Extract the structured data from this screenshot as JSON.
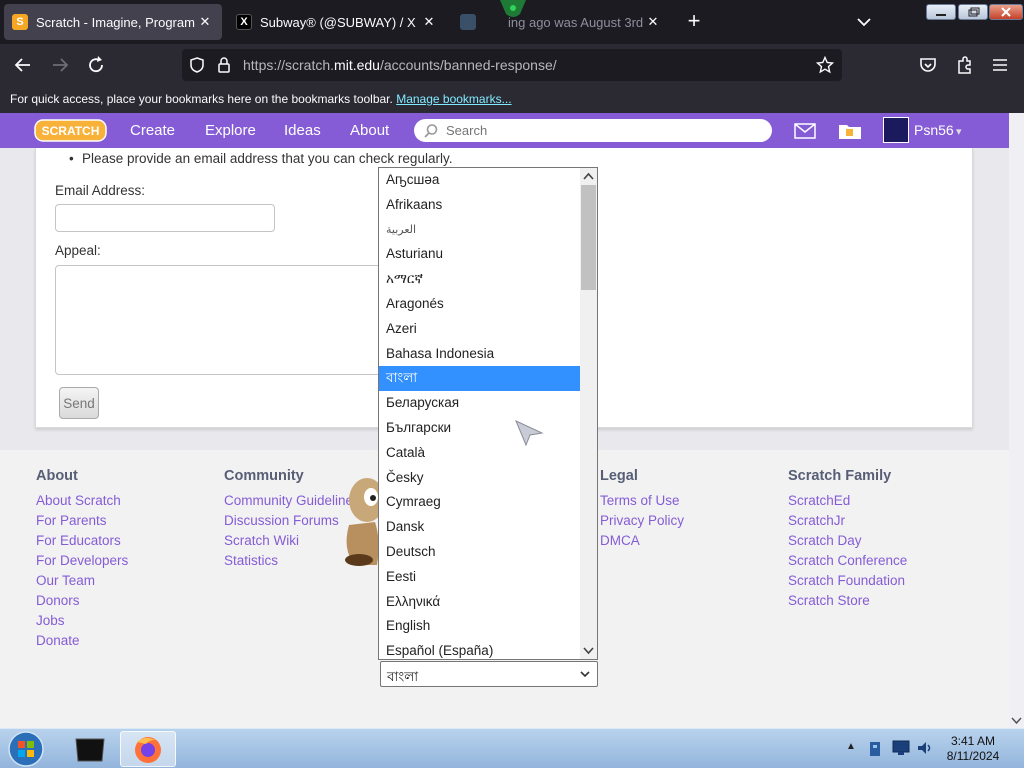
{
  "browser": {
    "tabs": [
      {
        "title": "Scratch - Imagine, Program, Sh",
        "close": "✕",
        "favicon": "scratch-cat-icon"
      },
      {
        "title": "Subway® (@SUBWAY) / X",
        "close": "✕",
        "favicon": "x-logo-icon"
      },
      {
        "title": "ing ago was August 3rd",
        "close": "✕",
        "favicon": "generic-page-icon"
      }
    ],
    "new_tab": "+",
    "url": {
      "prefix": "https://scratch.",
      "domain": "mit.edu",
      "path": "/accounts/banned-response/"
    },
    "bookmarks_bar": {
      "text": "For quick access, place your bookmarks here on the bookmarks toolbar.",
      "link": "Manage bookmarks..."
    }
  },
  "scratch_nav": {
    "logo": "SCRATCH",
    "links": [
      "Create",
      "Explore",
      "Ideas",
      "About"
    ],
    "search_placeholder": "Search",
    "username": "Psn56",
    "caret": "▾"
  },
  "form": {
    "bullet": "Please provide an email address that you can check regularly.",
    "email_label": "Email Address:",
    "appeal_label": "Appeal:",
    "send_label": "Send"
  },
  "footer": {
    "columns": [
      {
        "heading": "About",
        "links": [
          "About Scratch",
          "For Parents",
          "For Educators",
          "For Developers",
          "Our Team",
          "Donors",
          "Jobs",
          "Donate"
        ]
      },
      {
        "heading": "Community",
        "links": [
          "Community Guidelines",
          "Discussion Forums",
          "Scratch Wiki",
          "Statistics"
        ]
      },
      {
        "heading": "Legal",
        "links": [
          "Terms of Use",
          "Privacy Policy",
          "DMCA"
        ]
      },
      {
        "heading": "Scratch Family",
        "links": [
          "ScratchEd",
          "ScratchJr",
          "Scratch Day",
          "Scratch Conference",
          "Scratch Foundation",
          "Scratch Store"
        ]
      }
    ]
  },
  "language_dropdown": {
    "options": [
      "Аҧсшәа",
      "Afrikaans",
      "العربية",
      "Asturianu",
      "አማርኛ",
      "Aragonés",
      "Azeri",
      "Bahasa Indonesia",
      "বাংলা",
      "Беларуская",
      "Български",
      "Català",
      "Česky",
      "Cymraeg",
      "Dansk",
      "Deutsch",
      "Eesti",
      "Ελληνικά",
      "English",
      "Español (España)"
    ],
    "selected_index": 8,
    "selected_value": "বাংলা"
  },
  "taskbar": {
    "clock_time": "3:41 AM",
    "clock_date": "8/11/2024"
  },
  "colors": {
    "scratch_purple": "#855cd6",
    "link_purple": "#855cd6",
    "select_highlight": "#3390ff",
    "browser_dark": "#1c1b22"
  }
}
